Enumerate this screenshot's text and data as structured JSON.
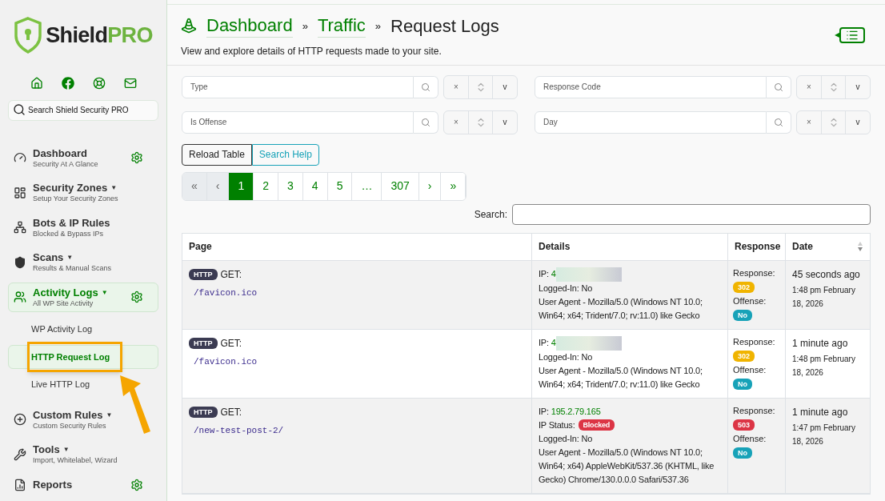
{
  "sidebar": {
    "logo": {
      "name": "Shield",
      "suffix": "PRO"
    },
    "search": {
      "placeholder": "Search Shield Security PRO"
    },
    "nav": [
      {
        "kind": "gauge",
        "title": "Dashboard",
        "subtitle": "Security At A Glance",
        "settings": true,
        "selected": false
      },
      {
        "kind": "zones",
        "title": "Security Zones",
        "caret": "▼",
        "subtitle": "Setup Your Security Zones",
        "settings": false,
        "selected": false
      },
      {
        "kind": "network",
        "title": "Bots & IP Rules",
        "subtitle": "Blocked & Bypass IPs",
        "settings": false,
        "selected": false
      },
      {
        "kind": "shield",
        "title": "Scans",
        "caret": "▼",
        "subtitle": "Results & Manual Scans",
        "settings": false,
        "selected": false
      },
      {
        "kind": "users",
        "title": "Activity Logs",
        "caret": "▼",
        "subtitle": "All WP Site Activity",
        "settings": true,
        "selected": true,
        "children": [
          {
            "label": "WP Activity Log",
            "selected": false,
            "highlighted": false
          },
          {
            "label": "HTTP Request Log",
            "selected": true,
            "highlighted": true
          },
          {
            "label": "Live HTTP Log",
            "selected": false,
            "highlighted": false
          }
        ]
      },
      {
        "kind": "rules",
        "title": "Custom Rules",
        "caret": "▼",
        "subtitle": "Custom Security Rules",
        "settings": false,
        "selected": false
      },
      {
        "kind": "tools",
        "title": "Tools",
        "caret": "▼",
        "subtitle": "Import, Whitelabel, Wizard",
        "settings": false,
        "selected": false
      },
      {
        "kind": "reports",
        "title": "Reports",
        "settings": true,
        "selected": false
      }
    ]
  },
  "header": {
    "breadcrumb": [
      {
        "label": "Dashboard",
        "link": true
      },
      {
        "label": "Traffic",
        "link": true
      },
      {
        "label": "Request Logs",
        "link": false
      }
    ],
    "separators": [
      "»",
      "»"
    ],
    "description": "View and explore details of HTTP requests made to your site.",
    "toggle_arrow": "◀"
  },
  "filters": [
    {
      "placeholder": "Type",
      "clear": "×",
      "dropdown": "v"
    },
    {
      "placeholder": "Response Code",
      "clear": "×",
      "dropdown": "v"
    },
    {
      "placeholder": "Is Offense",
      "clear": "×",
      "dropdown": "v"
    },
    {
      "placeholder": "Day",
      "clear": "×",
      "dropdown": "v"
    }
  ],
  "buttons": [
    {
      "label": "Reload Table",
      "kind": "dark"
    },
    {
      "label": "Search Help",
      "kind": "info"
    }
  ],
  "pagination": [
    {
      "label": "«",
      "selected": false,
      "disabled": true
    },
    {
      "label": "‹",
      "selected": false,
      "disabled": true
    },
    {
      "label": "1",
      "selected": true,
      "disabled": false
    },
    {
      "label": "2",
      "selected": false,
      "disabled": false
    },
    {
      "label": "3",
      "selected": false,
      "disabled": false
    },
    {
      "label": "4",
      "selected": false,
      "disabled": false
    },
    {
      "label": "5",
      "selected": false,
      "disabled": false
    },
    {
      "label": "…",
      "selected": false,
      "disabled": false
    },
    {
      "label": "307",
      "selected": false,
      "disabled": false
    },
    {
      "label": "›",
      "selected": false,
      "disabled": false
    },
    {
      "label": "»",
      "selected": false,
      "disabled": false
    }
  ],
  "search": {
    "label": "Search:"
  },
  "table": {
    "columns": [
      {
        "label": "Page",
        "sortable": false
      },
      {
        "label": "Details",
        "sortable": false
      },
      {
        "label": "Response",
        "sortable": false
      },
      {
        "label": "Date",
        "sortable": true
      }
    ],
    "rows": [
      {
        "badge": "HTTP",
        "method": "GET:",
        "path": "/favicon.ico",
        "ip_label": "IP:",
        "ip": "4",
        "ip_redacted": true,
        "logged_in": "Logged-In: No",
        "user_agent": "User Agent - Mozilla/5.0 (Windows NT 10.0; Win64; x64; Trident/7.0; rv:11.0) like Gecko",
        "response_label": "Response:",
        "code": "302",
        "color": "#f0b400",
        "offense_label": "Offense:",
        "offense": "No",
        "ago": "45 seconds ago",
        "date": "1:48 pm February 18, 2026"
      },
      {
        "badge": "HTTP",
        "method": "GET:",
        "path": "/favicon.ico",
        "ip_label": "IP:",
        "ip": "4",
        "ip_redacted": true,
        "logged_in": "Logged-In: No",
        "user_agent": "User Agent - Mozilla/5.0 (Windows NT 10.0; Win64; x64; Trident/7.0; rv:11.0) like Gecko",
        "response_label": "Response:",
        "code": "302",
        "color": "#f0b400",
        "offense_label": "Offense:",
        "offense": "No",
        "ago": "1 minute ago",
        "date": "1:48 pm February 18, 2026"
      },
      {
        "badge": "HTTP",
        "method": "GET:",
        "path": "/new-test-post-2/",
        "ip_label": "IP:",
        "ip": "195.2.79.165",
        "ip_redacted": false,
        "ip_status_label": "IP Status:",
        "ip_status": "Blocked",
        "logged_in": "Logged-In: No",
        "user_agent": "User Agent - Mozilla/5.0 (Windows NT 10.0; Win64; x64) AppleWebKit/537.36 (KHTML, like Gecko) Chrome/130.0.0.0 Safari/537.36",
        "response_label": "Response:",
        "code": "503",
        "color": "#dc3545",
        "offense_label": "Offense:",
        "offense": "No",
        "ago": "1 minute ago",
        "date": "1:47 pm February 18, 2026"
      }
    ]
  }
}
